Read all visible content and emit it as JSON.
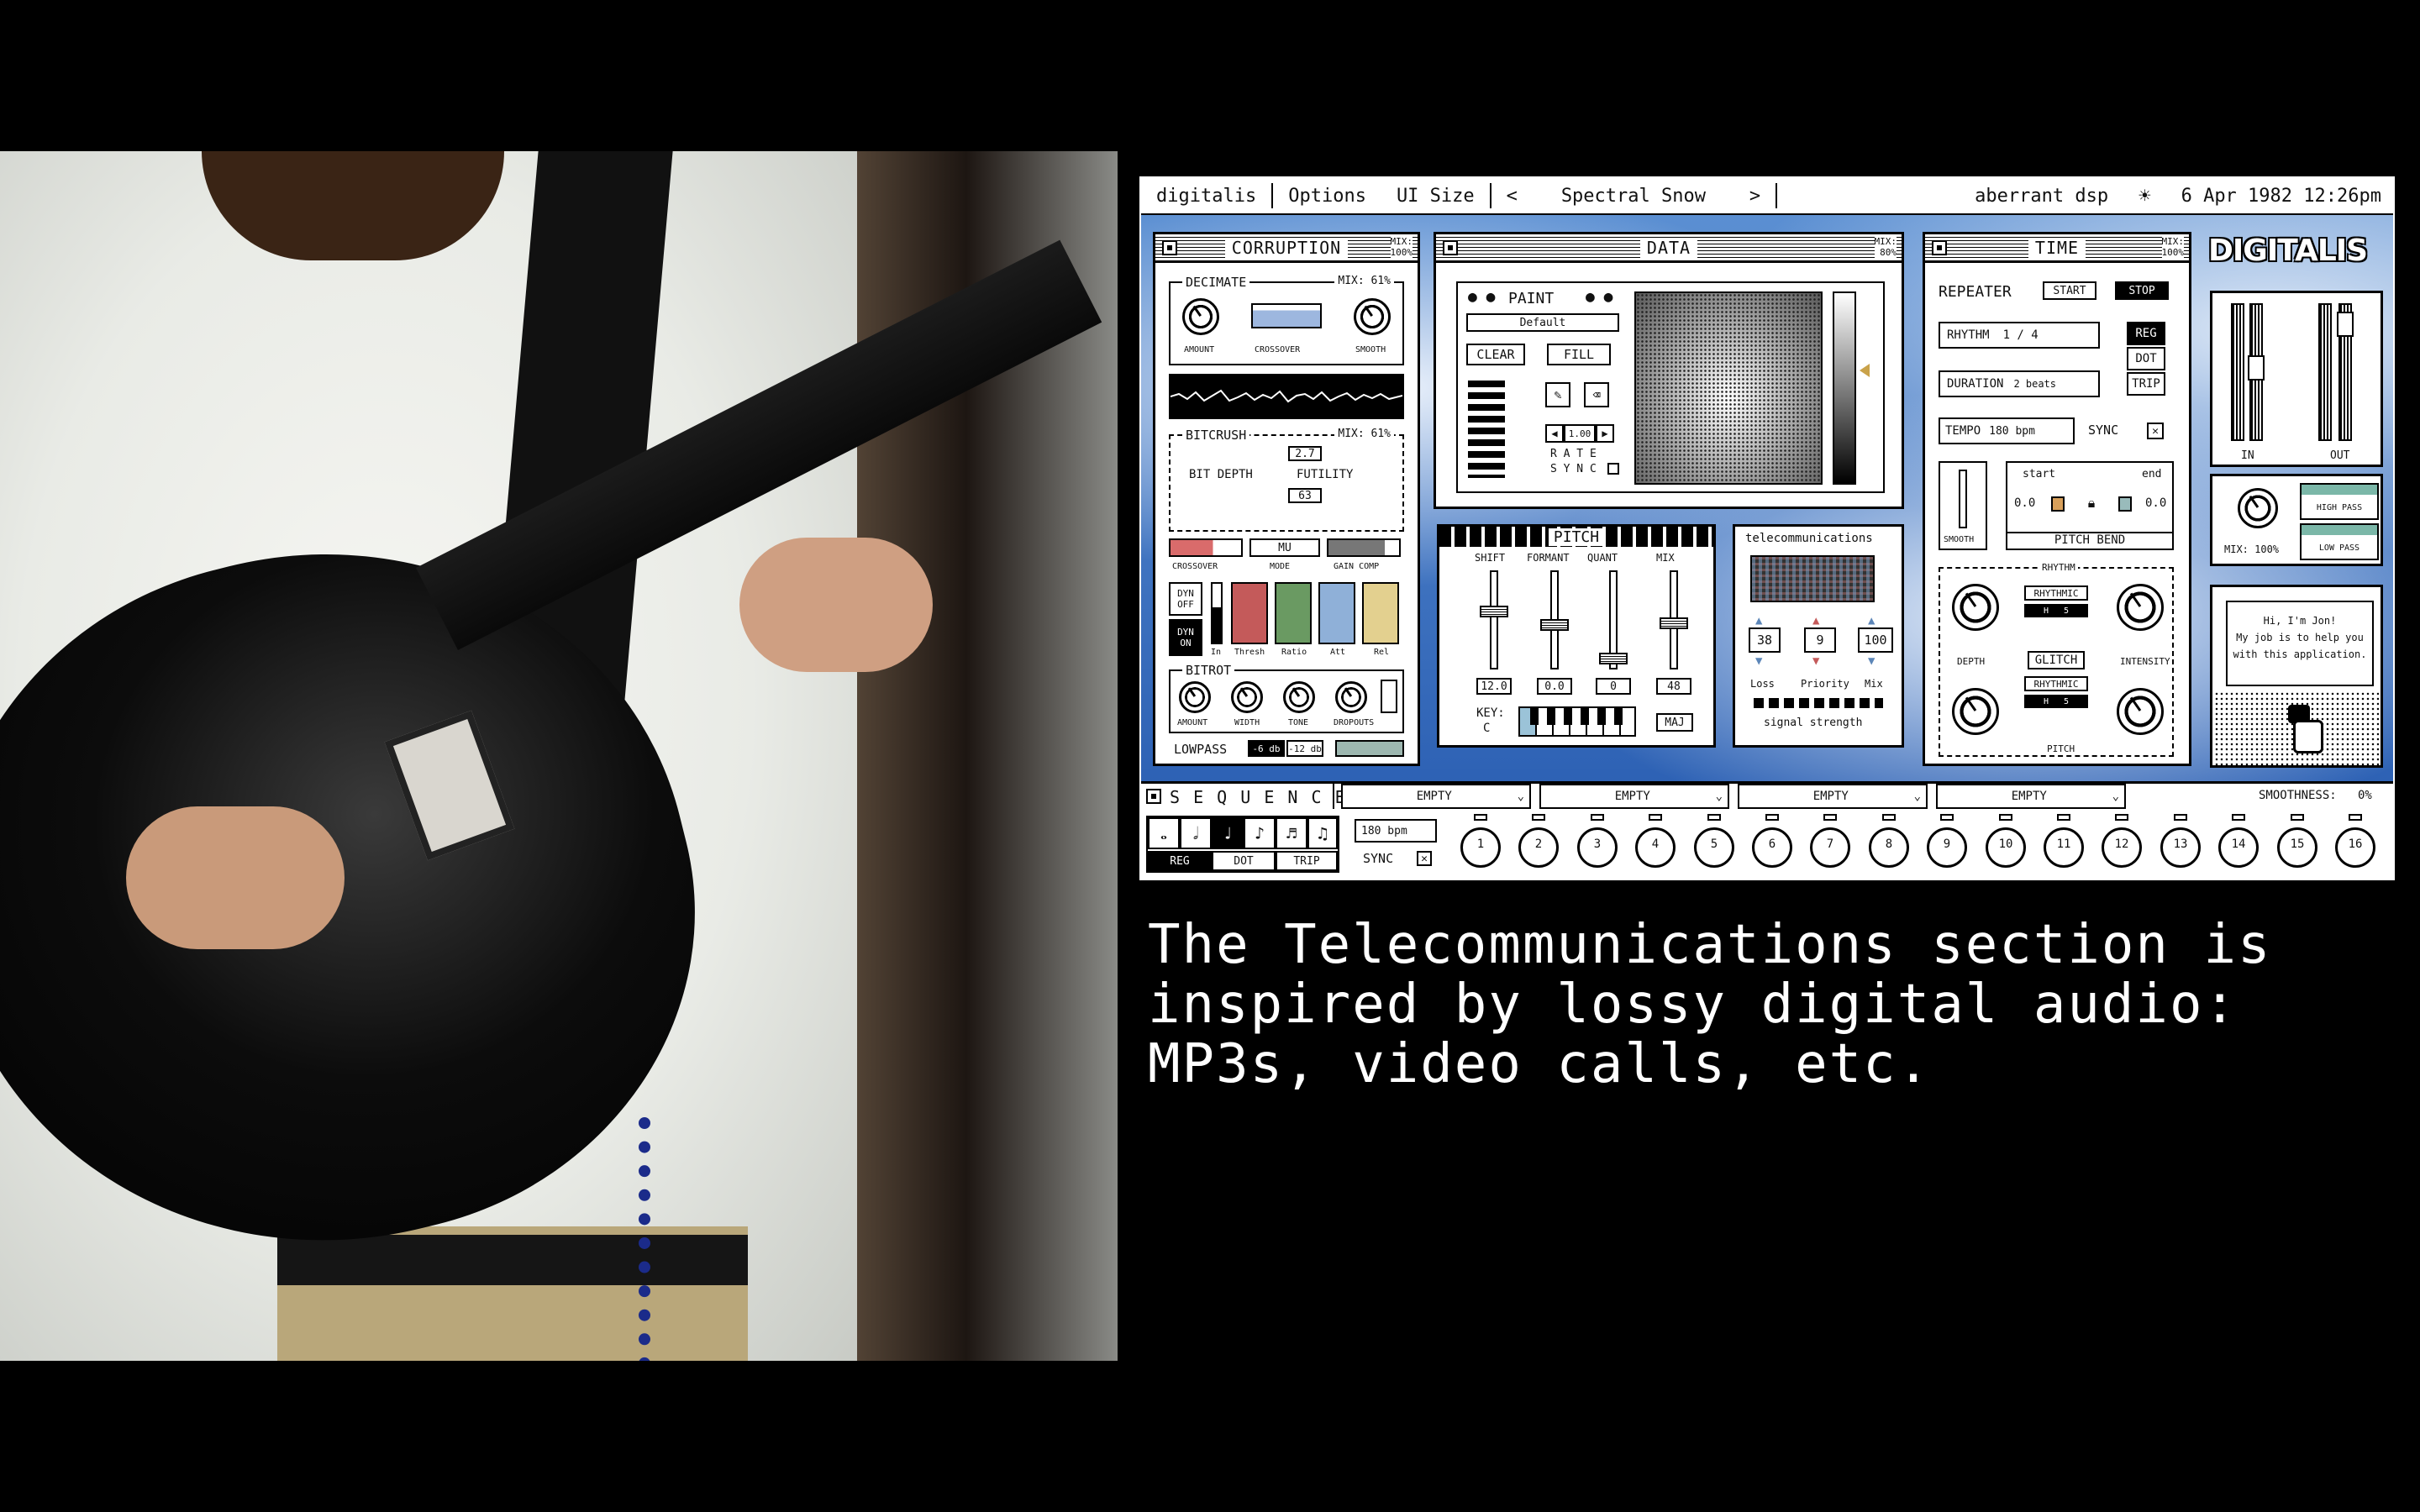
{
  "menubar": {
    "app": "digitalis",
    "options": "Options",
    "ui_size": "UI Size",
    "prev": "<",
    "preset": "Spectral Snow",
    "next": ">",
    "company": "aberrant dsp",
    "datetime": "6 Apr 1982 12:26pm"
  },
  "corruption": {
    "title": "CORRUPTION",
    "mix": "MIX:\n100%",
    "decimate": {
      "label": "DECIMATE",
      "mix": "MIX: 61%",
      "amount": "AMOUNT",
      "crossover": "CROSSOVER",
      "smooth": "SMOOTH"
    },
    "bitcrush": {
      "label": "BITCRUSH",
      "mix": "MIX: 61%",
      "val_top": "2.7",
      "bit_depth": "BIT DEPTH",
      "futility": "FUTILITY",
      "val_bottom": "63",
      "mode_val": "MU",
      "crossover": "CROSSOVER",
      "mode": "MODE",
      "gain_comp": "GAIN COMP"
    },
    "dyn_off": "DYN OFF",
    "dyn_on": "DYN ON",
    "dyn_bars": [
      "In",
      "Thresh",
      "Ratio",
      "Att",
      "Rel"
    ],
    "bitrot": {
      "label": "BITROT",
      "amount": "AMOUNT",
      "width": "WIDTH",
      "tone": "TONE",
      "dropouts": "DROPOUTS"
    },
    "lowpass": "LOWPASS",
    "lp_a": "-6 db",
    "lp_b": "-12 db"
  },
  "data": {
    "title": "DATA",
    "mix": "MIX:\n80%",
    "paint": "PAINT",
    "preset": "Default",
    "clear": "CLEAR",
    "fill": "FILL",
    "rate_val": "1.00",
    "rate": "R A T E",
    "sync": "S Y N C"
  },
  "pitch": {
    "title": "PITCH",
    "cols": [
      "SHIFT",
      "FORMANT",
      "QUANT",
      "MIX"
    ],
    "values": [
      "12.0",
      "0.0",
      "0",
      "48"
    ],
    "key": "KEY:",
    "key_val": "C",
    "scale": "MAJ"
  },
  "telecom": {
    "title": "telecommunications",
    "values": [
      "38",
      "9",
      "100"
    ],
    "labels": [
      "Loss",
      "Priority",
      "Mix"
    ],
    "signal": "signal strength"
  },
  "time": {
    "title": "TIME",
    "mix": "MIX:\n100%",
    "repeater": "REPEATER",
    "start": "START",
    "stop": "STOP",
    "rhythm": "RHYTHM",
    "rhythm_val": "1 / 4",
    "reg": "REG",
    "dot": "DOT",
    "trip": "TRIP",
    "duration": "DURATION",
    "duration_val": "2 beats",
    "tempo": "TEMPO",
    "tempo_val": "180 bpm",
    "sync": "SYNC",
    "smooth": "SMOOTH",
    "start_lbl": "start",
    "end_lbl": "end",
    "start_val": "0.0",
    "end_val": "0.0",
    "pitch_bend": "PITCH BEND",
    "rhythm_tab": "RHYTHM",
    "rhythmic": "RHYTHMIC",
    "depth": "DEPTH",
    "glitch": "GLITCH",
    "intensity": "INTENSITY",
    "pitch_tab": "PITCH"
  },
  "right": {
    "logo": "DIGITALIS",
    "in": "IN",
    "out": "OUT",
    "mix": "MIX: 100%",
    "high_pass": "HIGH PASS",
    "low_pass": "LOW PASS",
    "assistant": "Hi, I'm Jon!\nMy job is to help you\nwith this application."
  },
  "sequencer": {
    "title": "S E Q U E N C E R",
    "slots": [
      "EMPTY",
      "EMPTY",
      "EMPTY",
      "EMPTY"
    ],
    "smoothness": "SMOOTHNESS:",
    "smoothness_val": "0%",
    "tempo": "180 bpm",
    "sync": "SYNC",
    "reg": "REG",
    "dot": "DOT",
    "trip": "TRIP",
    "steps": [
      "1",
      "2",
      "3",
      "4",
      "5",
      "6",
      "7",
      "8",
      "9",
      "10",
      "11",
      "12",
      "13",
      "14",
      "15",
      "16"
    ]
  },
  "caption": "The Telecommunications section is\ninspired by lossy digital audio:\nMP3s, video calls, etc.",
  "colors": {
    "sky": "#2f67b9",
    "caption": "#ffffff",
    "dyn_thresh": "#c45a5a",
    "dyn_ratio": "#6a9a62",
    "dyn_att": "#8fb0d8",
    "dyn_rel": "#e3d08f"
  }
}
